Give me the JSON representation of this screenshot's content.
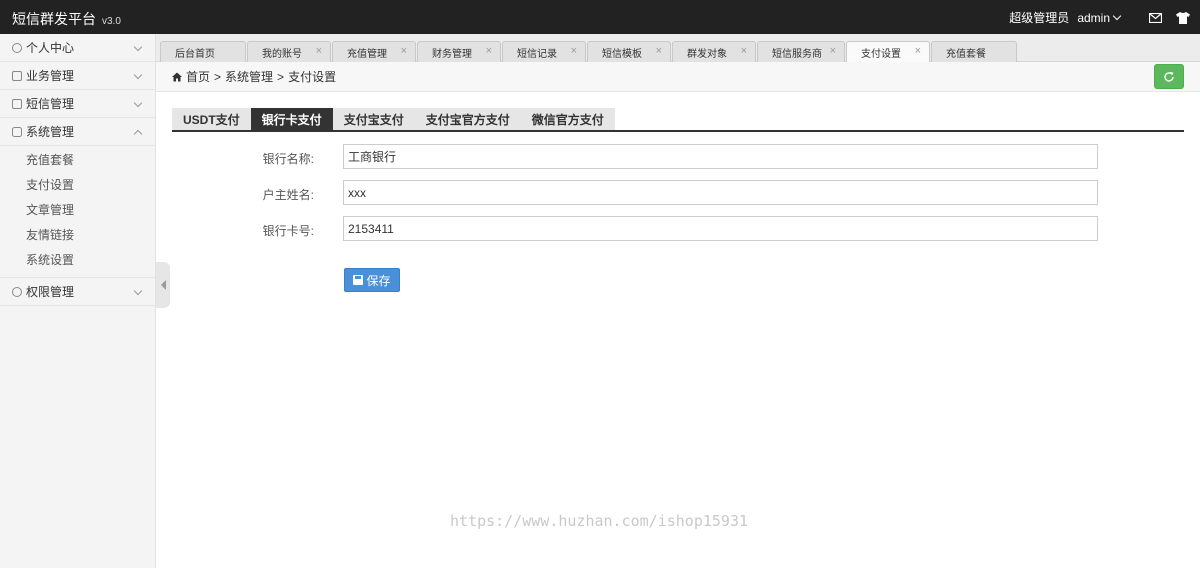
{
  "app": {
    "title": "短信群发平台",
    "version": "v3.0"
  },
  "header": {
    "role": "超级管理员",
    "user": "admin",
    "icons": [
      "mail-icon",
      "shirt-icon"
    ]
  },
  "sidebar": {
    "groups": [
      {
        "label": "个人中心",
        "icon": "user-icon",
        "expanded": false
      },
      {
        "label": "业务管理",
        "icon": "business-icon",
        "expanded": false
      },
      {
        "label": "短信管理",
        "icon": "sms-icon",
        "expanded": false
      },
      {
        "label": "系统管理",
        "icon": "database-icon",
        "expanded": true
      },
      {
        "label": "权限管理",
        "icon": "users-icon",
        "expanded": false
      }
    ],
    "system_items": [
      "充值套餐",
      "支付设置",
      "文章管理",
      "友情链接",
      "系统设置"
    ]
  },
  "tabs": [
    {
      "label": "后台首页",
      "closable": false
    },
    {
      "label": "我的账号",
      "closable": true
    },
    {
      "label": "充值管理",
      "closable": true
    },
    {
      "label": "财务管理",
      "closable": true
    },
    {
      "label": "短信记录",
      "closable": true
    },
    {
      "label": "短信模板",
      "closable": true
    },
    {
      "label": "群发对象",
      "closable": true
    },
    {
      "label": "短信服务商",
      "closable": true
    },
    {
      "label": "支付设置",
      "closable": true,
      "active": true
    },
    {
      "label": "充值套餐",
      "closable": false
    }
  ],
  "breadcrumb": {
    "home": "首页",
    "sep": ">",
    "section": "系统管理",
    "page": "支付设置"
  },
  "payment_tabs": [
    {
      "label": "USDT支付",
      "active": false
    },
    {
      "label": "银行卡支付",
      "active": true
    },
    {
      "label": "支付宝支付",
      "active": false
    },
    {
      "label": "支付宝官方支付",
      "active": false
    },
    {
      "label": "微信官方支付",
      "active": false
    }
  ],
  "form": {
    "bank_name": {
      "label": "银行名称:",
      "value": "工商银行"
    },
    "holder_name": {
      "label": "户主姓名:",
      "value": "xxx"
    },
    "card_number": {
      "label": "银行卡号:",
      "value": "2153411"
    },
    "save_label": "保存"
  },
  "watermark": "https://www.huzhan.com/ishop15931",
  "colors": {
    "topbar": "#222222",
    "refresh": "#5cb85c",
    "save": "#4a90d9",
    "active_tab": "#333333"
  }
}
